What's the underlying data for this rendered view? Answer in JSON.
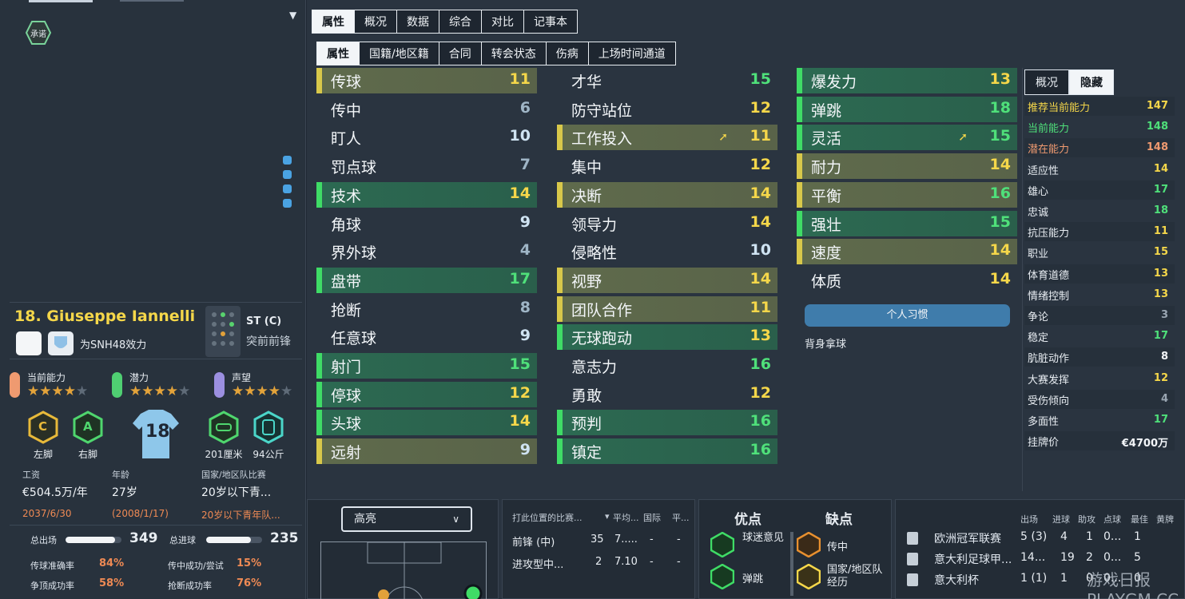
{
  "pledge": {
    "label": "承诺"
  },
  "player": {
    "name": "18. Giuseppe Iannelli",
    "team": "为SNH48效力",
    "pos_main": "ST (C)",
    "pos_sub": "突前前锋"
  },
  "ratings": [
    {
      "label": "当前能力",
      "stars": 4,
      "color": "#ef9a70"
    },
    {
      "label": "潜力",
      "stars": 4,
      "color": "#4fcf72"
    },
    {
      "label": "声望",
      "stars": 4,
      "color": "#9b8fe0"
    }
  ],
  "body": {
    "left_foot": "左脚",
    "right_foot": "右脚",
    "left_grade": "C",
    "right_grade": "A",
    "number": "18",
    "height": "201厘米",
    "weight": "94公斤"
  },
  "finance": {
    "wage_l": "工资",
    "wage": "€504.5万/年",
    "wage_exp": "2037/6/30",
    "age_l": "年龄",
    "age": "27岁",
    "dob": "(2008/1/17)",
    "nat_l": "国家/地区队比赛",
    "nat": "20岁以下青...",
    "nat_r": "20岁以下青年队..."
  },
  "stats": {
    "apps_l": "总出场",
    "apps": "349",
    "apps_fill": 0.88,
    "goals_l": "总进球",
    "goals": "235",
    "goals_fill": 0.8,
    "pass_l": "传球准确率",
    "pass": "84%",
    "cross_l": "传中成功/尝试",
    "cross": "15%",
    "header_l": "争顶成功率",
    "header": "58%",
    "tackle_l": "抢断成功率",
    "tackle": "76%"
  },
  "tabs1": [
    "属性",
    "概况",
    "数据",
    "综合",
    "对比",
    "记事本"
  ],
  "tabs2": [
    "属性",
    "国籍/地区籍",
    "合同",
    "转会状态",
    "伤病",
    "上场时间通道"
  ],
  "technical": [
    {
      "n": "传球",
      "v": "11",
      "k": "y"
    },
    {
      "n": "传中",
      "v": "6",
      "k": "n"
    },
    {
      "n": "盯人",
      "v": "10",
      "k": "n"
    },
    {
      "n": "罚点球",
      "v": "7",
      "k": "n"
    },
    {
      "n": "技术",
      "v": "14",
      "k": "g"
    },
    {
      "n": "角球",
      "v": "9",
      "k": "n"
    },
    {
      "n": "界外球",
      "v": "4",
      "k": "n"
    },
    {
      "n": "盘带",
      "v": "17",
      "k": "g"
    },
    {
      "n": "抢断",
      "v": "8",
      "k": "n"
    },
    {
      "n": "任意球",
      "v": "9",
      "k": "n"
    },
    {
      "n": "射门",
      "v": "15",
      "k": "g"
    },
    {
      "n": "停球",
      "v": "12",
      "k": "g"
    },
    {
      "n": "头球",
      "v": "14",
      "k": "g"
    },
    {
      "n": "远射",
      "v": "9",
      "k": "y"
    }
  ],
  "mental": [
    {
      "n": "才华",
      "v": "15",
      "k": "n"
    },
    {
      "n": "防守站位",
      "v": "12",
      "k": "n"
    },
    {
      "n": "工作投入",
      "v": "11",
      "k": "y",
      "up": true
    },
    {
      "n": "集中",
      "v": "12",
      "k": "n"
    },
    {
      "n": "决断",
      "v": "14",
      "k": "y"
    },
    {
      "n": "领导力",
      "v": "14",
      "k": "n"
    },
    {
      "n": "侵略性",
      "v": "10",
      "k": "n"
    },
    {
      "n": "视野",
      "v": "14",
      "k": "y"
    },
    {
      "n": "团队合作",
      "v": "11",
      "k": "y"
    },
    {
      "n": "无球跑动",
      "v": "13",
      "k": "g"
    },
    {
      "n": "意志力",
      "v": "16",
      "k": "n"
    },
    {
      "n": "勇敢",
      "v": "12",
      "k": "n"
    },
    {
      "n": "预判",
      "v": "16",
      "k": "g"
    },
    {
      "n": "镇定",
      "v": "16",
      "k": "g"
    }
  ],
  "physical": [
    {
      "n": "爆发力",
      "v": "13",
      "k": "g"
    },
    {
      "n": "弹跳",
      "v": "18",
      "k": "g"
    },
    {
      "n": "灵活",
      "v": "15",
      "k": "g",
      "up": true
    },
    {
      "n": "耐力",
      "v": "14",
      "k": "y"
    },
    {
      "n": "平衡",
      "v": "16",
      "k": "y"
    },
    {
      "n": "强壮",
      "v": "15",
      "k": "g"
    },
    {
      "n": "速度",
      "v": "14",
      "k": "y"
    },
    {
      "n": "体质",
      "v": "14",
      "k": "n"
    }
  ],
  "habit": {
    "button": "个人习惯",
    "item": "背身拿球"
  },
  "hidden": {
    "tabs": [
      "概况",
      "隐藏"
    ],
    "rows": [
      {
        "n": "推荐当前能力",
        "v": "147",
        "c": "#f5d74a"
      },
      {
        "n": "当前能力",
        "v": "148",
        "c": "#4fe07a"
      },
      {
        "n": "潜在能力",
        "v": "148",
        "c": "#ef9a70"
      },
      {
        "n": "适应性",
        "v": "14",
        "c": "#f5d74a"
      },
      {
        "n": "雄心",
        "v": "17",
        "c": "#4fe07a"
      },
      {
        "n": "忠诚",
        "v": "18",
        "c": "#4fe07a"
      },
      {
        "n": "抗压能力",
        "v": "11",
        "c": "#f5d74a"
      },
      {
        "n": "职业",
        "v": "15",
        "c": "#f5d74a"
      },
      {
        "n": "体育道德",
        "v": "13",
        "c": "#f5d74a"
      },
      {
        "n": "情绪控制",
        "v": "13",
        "c": "#f5d74a"
      },
      {
        "n": "争论",
        "v": "3",
        "c": "#9aa6b2"
      },
      {
        "n": "稳定",
        "v": "17",
        "c": "#4fe07a"
      },
      {
        "n": "肮脏动作",
        "v": "8",
        "c": "#f3f6f9"
      },
      {
        "n": "大赛发挥",
        "v": "12",
        "c": "#f5d74a"
      },
      {
        "n": "受伤倾向",
        "v": "4",
        "c": "#9aa6b2"
      },
      {
        "n": "多面性",
        "v": "17",
        "c": "#4fe07a"
      },
      {
        "n": "挂牌价",
        "v": "€4700万",
        "c": "#f3f6f9"
      }
    ]
  },
  "highlight": {
    "label": "高亮"
  },
  "positions": {
    "headers": [
      "打此位置的比赛...",
      "平均...",
      "国际",
      "平..."
    ],
    "rows": [
      [
        "前锋 (中)",
        "35",
        "7.....",
        "-",
        "-"
      ],
      [
        "进攻型中...",
        "2",
        "7.10",
        "-",
        "-"
      ]
    ]
  },
  "strengths": {
    "title_s": "优点",
    "title_w": "缺点",
    "s": [
      "球迷意见",
      "弹跳"
    ],
    "w": [
      "传中",
      "国家/地区队经历"
    ]
  },
  "comps": {
    "headers": [
      "出场",
      "进球",
      "助攻",
      "点球",
      "最佳",
      "黄牌"
    ],
    "rows": [
      [
        "欧洲冠军联赛",
        "5 (3)",
        "4",
        "1",
        "0...",
        "1"
      ],
      [
        "意大利足球甲...",
        "14...",
        "19",
        "2",
        "0...",
        "5"
      ],
      [
        "意大利杯",
        "1 (1)",
        "1",
        "0",
        "0...",
        "0"
      ]
    ]
  },
  "watermark": "游戏日报 PLAYGM.CC"
}
